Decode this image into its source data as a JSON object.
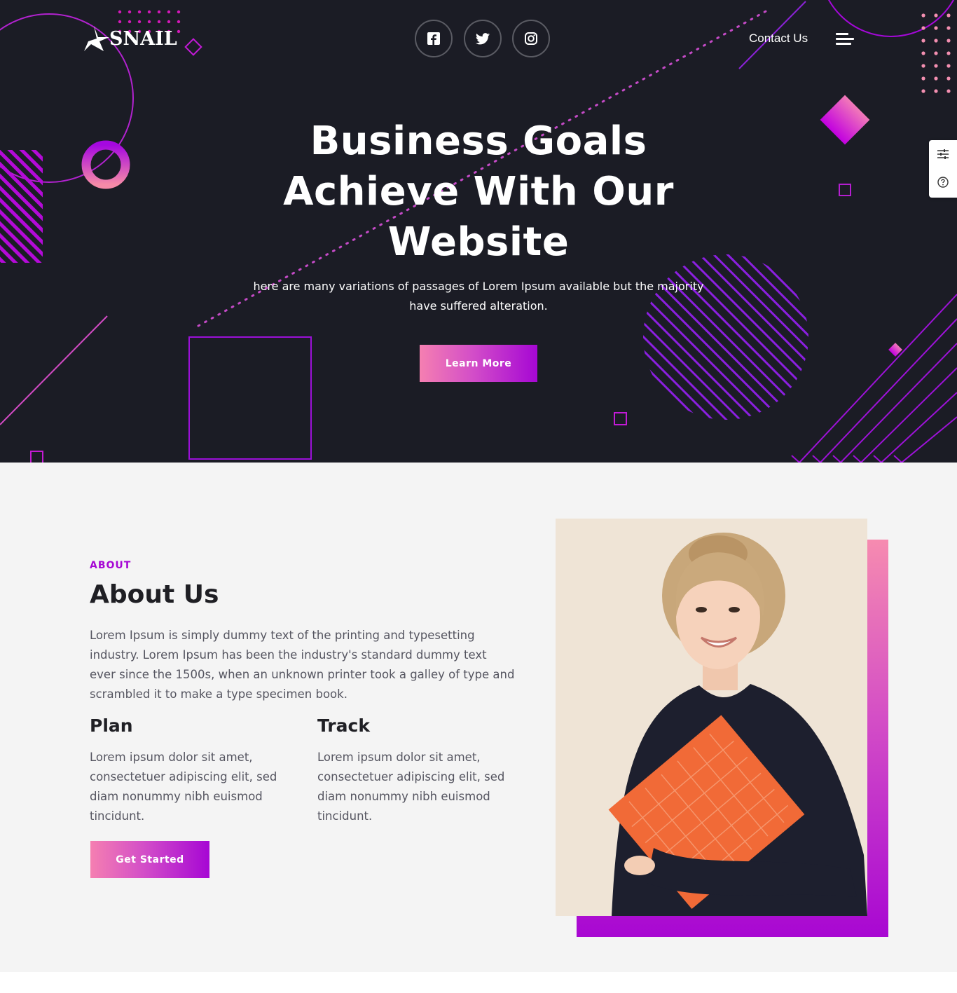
{
  "brand": {
    "name": "SNAIL"
  },
  "header": {
    "social": [
      {
        "name": "facebook-icon"
      },
      {
        "name": "twitter-icon"
      },
      {
        "name": "instagram-icon"
      }
    ],
    "contact_label": "Contact Us"
  },
  "hero": {
    "title_line1": "Business Goals",
    "title_line2": "Achieve With Our",
    "title_line3": "Website",
    "subtitle_line1": "here are many variations of passages of Lorem Ipsum available but the majority",
    "subtitle_line2": "have suffered alteration.",
    "cta_label": "Learn More"
  },
  "about": {
    "eyebrow": "ABOUT",
    "title": "About Us",
    "text_line1": "Lorem Ipsum is simply dummy text of the printing and typesetting",
    "text_line2": "industry. Lorem Ipsum has been the industry's standard dummy text",
    "text_line3": "ever since the 1500s, when an unknown printer took a galley of type and",
    "text_line4": "scrambled it to make a type specimen book.",
    "features": [
      {
        "title": "Plan",
        "line1": "Lorem ipsum dolor sit amet,",
        "line2": "consectetuer adipiscing elit, sed",
        "line3": "diam nonummy nibh euismod",
        "line4": "tincidunt."
      },
      {
        "title": "Track",
        "line1": "Lorem ipsum dolor sit amet,",
        "line2": "consectetuer adipiscing elit, sed",
        "line3": "diam nonummy nibh euismod",
        "line4": "tincidunt."
      }
    ],
    "cta_label": "Get Started"
  },
  "colors": {
    "hero_bg": "#1b1c25",
    "accent_pink": "#f57fb1",
    "accent_purple": "#a607d4",
    "section_bg": "#f4f4f4"
  }
}
